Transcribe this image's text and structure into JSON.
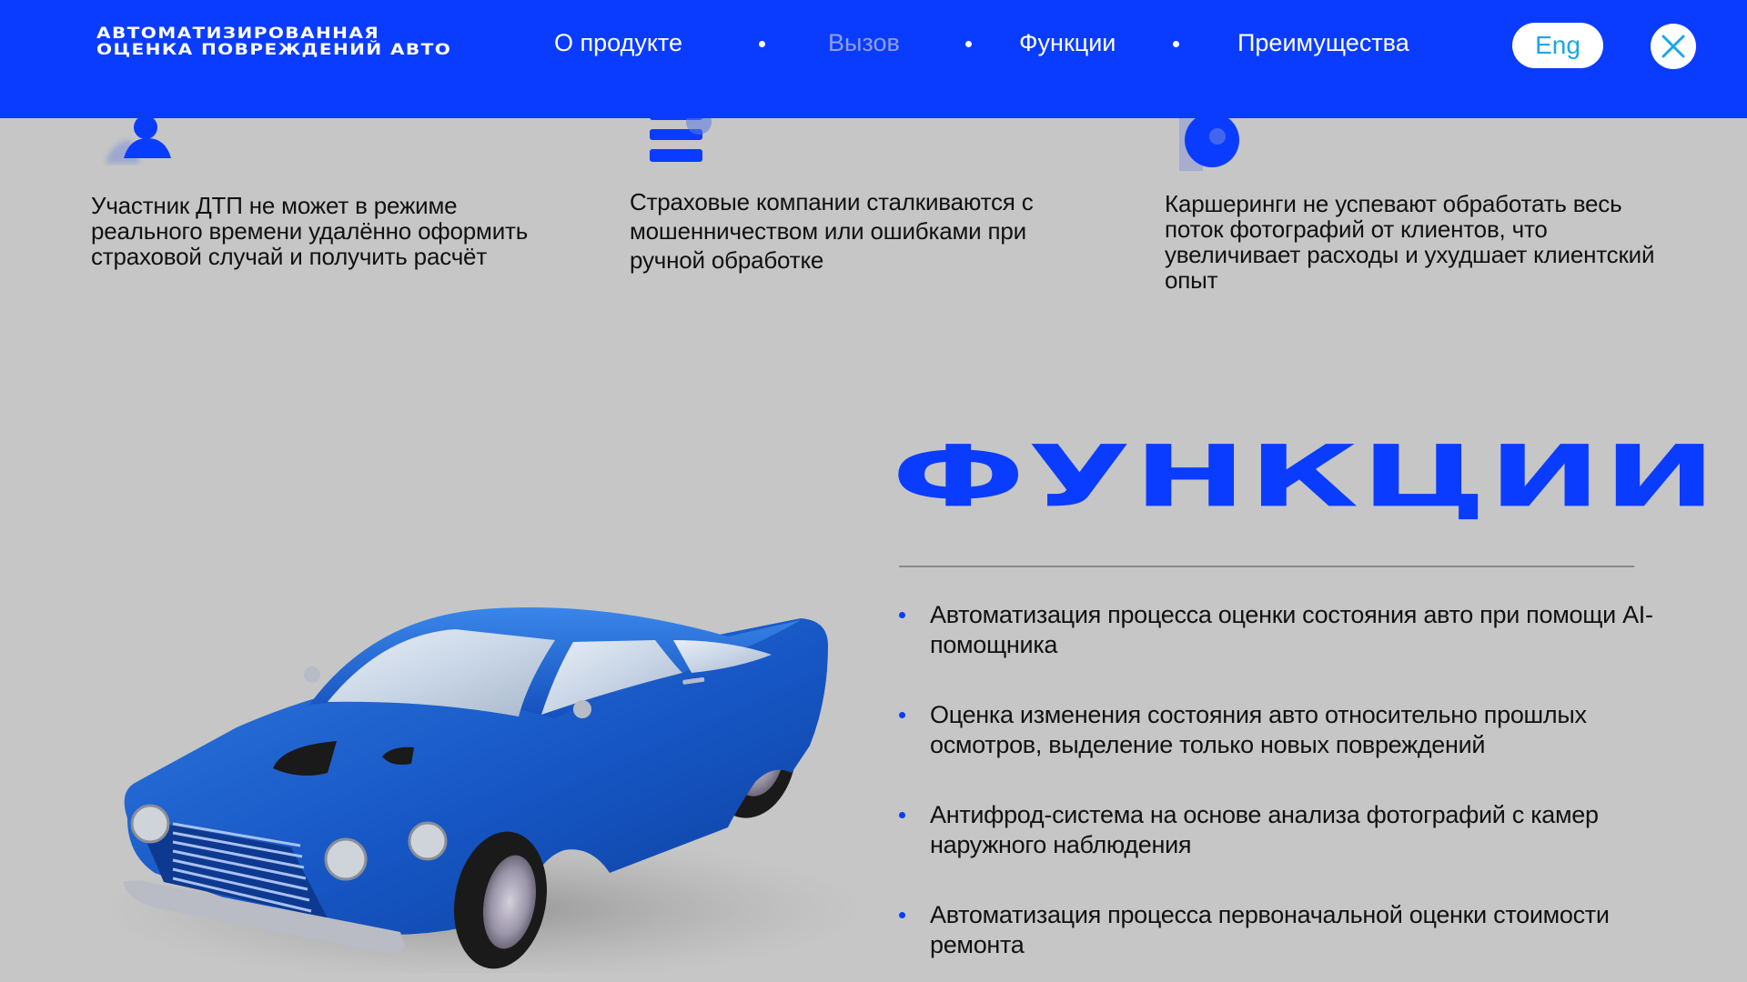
{
  "header": {
    "brand_line1": "АВТОМАТИЗИРОВАННАЯ",
    "brand_line2": "ОЦЕНКА ПОВРЕЖДЕНИЙ АВТО",
    "nav": [
      {
        "label": "О продукте",
        "active": false
      },
      {
        "label": "Вызов",
        "active": true
      },
      {
        "label": "Функции",
        "active": false
      },
      {
        "label": "Преимущества",
        "active": false
      }
    ],
    "lang_label": "Eng",
    "close_icon": "close-icon"
  },
  "challenges": [
    {
      "icon": "person-icon",
      "text": "Участник ДТП не может в режиме реального времени удалённо оформить страховой случай и получить расчёт"
    },
    {
      "icon": "stack-icon",
      "text": "Страховые компании сталкиваются с мошенничеством или ошибками при ручной обработке"
    },
    {
      "icon": "clock-icon",
      "text": "Каршеринги не успевают обработать весь поток фотографий от клиентов, что увеличивает расходы и ухудшает клиентский опыт"
    }
  ],
  "functions": {
    "title": "ФУНКЦИИ",
    "items": [
      "Автоматизация процесса оценки состояния авто при помощи AI-помощника",
      "Оценка изменения состояния авто относительно прошлых осмотров, выделение только новых повреждений",
      "Антифрод-система на основе анализа фотографий с камер наружного наблюдения",
      "Автоматизация процесса первоначальной оценки стоимости ремонта"
    ]
  },
  "illustration": {
    "name": "blue-car-illustration",
    "color": "#1b5fcc"
  },
  "colors": {
    "accent": "#0a3cff",
    "background": "#c6c6c6",
    "active_nav": "#8f9fe8",
    "lang_text": "#18a8e8"
  }
}
